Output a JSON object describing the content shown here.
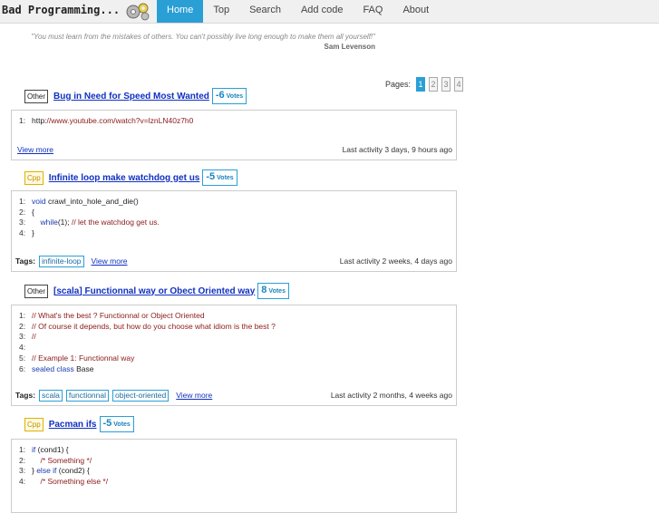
{
  "brand": "Bad Programming...",
  "nav": [
    "Home",
    "Top",
    "Search",
    "Add code",
    "FAQ",
    "About"
  ],
  "quote": "\"You must learn from the mistakes of others. You can't possibly live long enough to make them all yourself!\"",
  "author": "Sam Levenson",
  "pagination": {
    "label": "Pages:",
    "pages": [
      "1",
      "2",
      "3",
      "4"
    ],
    "current": "1"
  },
  "posts": [
    {
      "lang": "Other",
      "title": "Bug in Need for Speed Most Wanted",
      "votes": "-6",
      "votes_label": "Votes",
      "code": [
        {
          "n": "1:",
          "parts": [
            [
              "",
              "http:"
            ],
            [
              "st",
              "//www.youtube.com/watch?v=lznLN40z7h0"
            ]
          ]
        }
      ],
      "tags_label": "",
      "tags": [],
      "view_more": "View more",
      "activity": "Last activity 3 days, 9 hours ago"
    },
    {
      "lang": "Cpp",
      "title": "Infinite loop make watchdog get us",
      "votes": "-5",
      "votes_label": "Votes",
      "code": [
        {
          "n": "1:",
          "parts": [
            [
              "kw",
              "void"
            ],
            [
              "",
              " crawl_into_hole_and_die()"
            ]
          ]
        },
        {
          "n": "2:",
          "parts": [
            [
              "",
              "{"
            ]
          ]
        },
        {
          "n": "3:",
          "parts": [
            [
              "",
              "    "
            ],
            [
              "kw",
              "while"
            ],
            [
              "",
              "(1); "
            ],
            [
              "cm",
              "// let the watchdog get us."
            ]
          ]
        },
        {
          "n": "4:",
          "parts": [
            [
              "",
              "}"
            ]
          ]
        }
      ],
      "tags_label": "Tags:",
      "tags": [
        "infinite-loop"
      ],
      "view_more": "View more",
      "activity": "Last activity 2 weeks, 4 days ago"
    },
    {
      "lang": "Other",
      "title": "[scala] Functionnal way or Obect Oriented way",
      "votes": "8",
      "votes_label": "Votes",
      "code": [
        {
          "n": "1:",
          "parts": [
            [
              "cm",
              "// What's the best ? Functionnal or Object Oriented"
            ]
          ]
        },
        {
          "n": "2:",
          "parts": [
            [
              "cm",
              "// Of course it depends, but how do you choose what idiom is the best ?"
            ]
          ]
        },
        {
          "n": "3:",
          "parts": [
            [
              "cm",
              "//"
            ]
          ]
        },
        {
          "n": "4:",
          "parts": [
            [
              "",
              ""
            ]
          ]
        },
        {
          "n": "5:",
          "parts": [
            [
              "cm",
              "// Example 1: Functionnal way"
            ]
          ]
        },
        {
          "n": "6:",
          "parts": [
            [
              "kw",
              "sealed class"
            ],
            [
              "",
              " Base"
            ]
          ]
        }
      ],
      "tags_label": "Tags:",
      "tags": [
        "scala",
        "functionnal",
        "object-oriented"
      ],
      "view_more": "View more",
      "activity": "Last activity 2 months, 4 weeks ago"
    },
    {
      "lang": "Cpp",
      "title": "Pacman ifs",
      "votes": "-5",
      "votes_label": "Votes",
      "code": [
        {
          "n": "1:",
          "parts": [
            [
              "kw",
              "if"
            ],
            [
              "",
              " (cond1) {"
            ]
          ]
        },
        {
          "n": "2:",
          "parts": [
            [
              "",
              "    "
            ],
            [
              "cm",
              "/* Something */"
            ]
          ]
        },
        {
          "n": "3:",
          "parts": [
            [
              "",
              "} "
            ],
            [
              "kw",
              "else if"
            ],
            [
              "",
              " (cond2) {"
            ]
          ]
        },
        {
          "n": "4:",
          "parts": [
            [
              "",
              "    "
            ],
            [
              "cm",
              "/* Something else */"
            ]
          ]
        }
      ]
    }
  ]
}
